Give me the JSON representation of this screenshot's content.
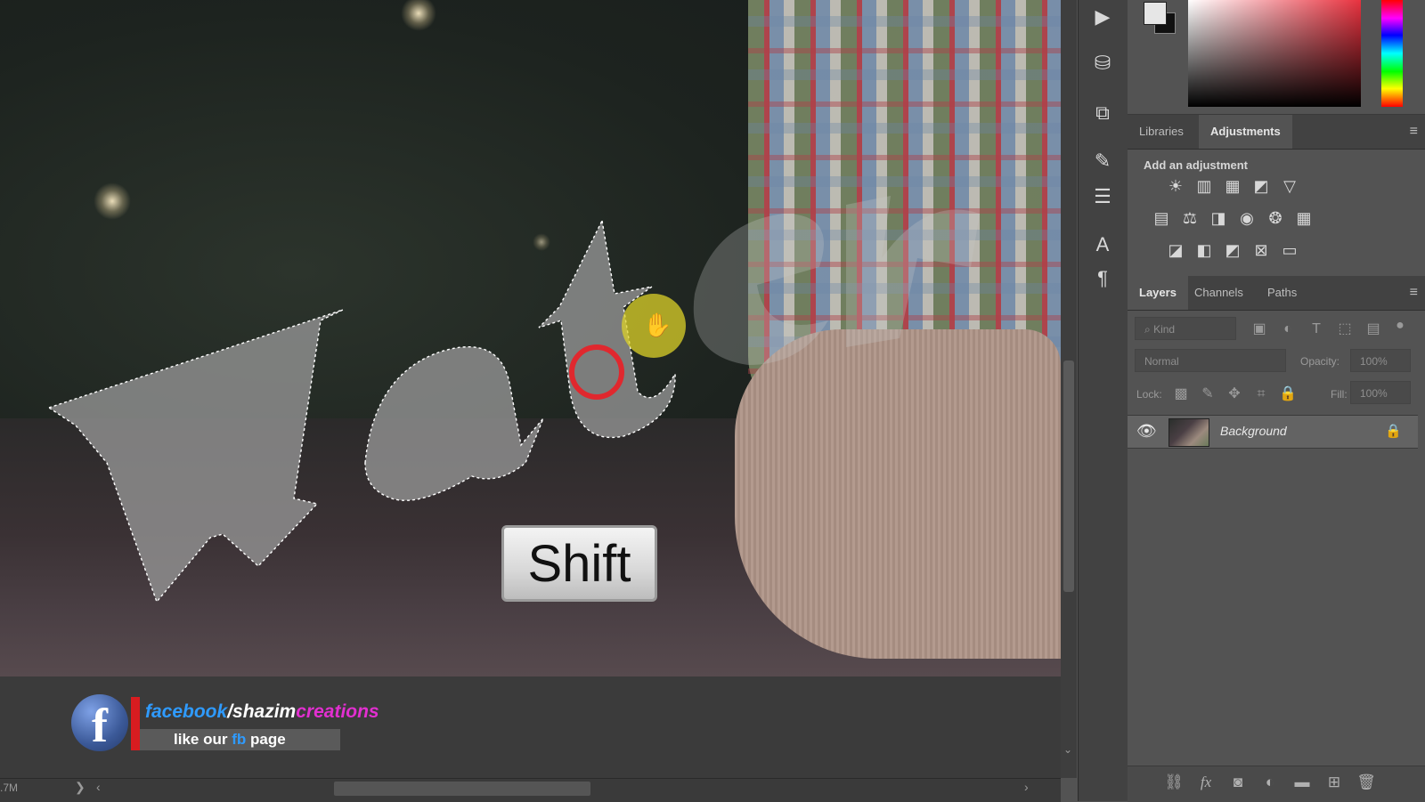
{
  "canvas": {
    "shift_key_label": "Shift",
    "status_doc_size": ".7M"
  },
  "watermark": {
    "facebook_part": "facebook",
    "slash_part": "/shazim",
    "creations_part": "creations",
    "like_prefix": "like our",
    "like_fb": "fb",
    "like_suffix": "page",
    "colors": {
      "facebook": "#2f9bff",
      "slash": "#ffffff",
      "creations": "#e22fd0",
      "fb_word": "#2f9bff"
    }
  },
  "top_panel": {
    "tabs": [
      {
        "label": "Libraries",
        "active": false
      },
      {
        "label": "Adjustments",
        "active": true
      }
    ],
    "section_title": "Add an adjustment",
    "adjustment_icons_row1": [
      "brightness-contrast-icon",
      "levels-icon",
      "curves-icon",
      "exposure-icon",
      "vibrance-icon"
    ],
    "adjustment_icons_row2": [
      "hue-saturation-icon",
      "color-balance-icon",
      "black-white-icon",
      "photo-filter-icon",
      "channel-mixer-icon",
      "color-lookup-icon"
    ],
    "adjustment_icons_row3": [
      "invert-icon",
      "posterize-icon",
      "threshold-icon",
      "selective-color-icon",
      "gradient-map-icon"
    ]
  },
  "layers_panel": {
    "tabs": [
      {
        "label": "Layers",
        "active": true
      },
      {
        "label": "Channels",
        "active": false
      },
      {
        "label": "Paths",
        "active": false
      }
    ],
    "filter_placeholder": "Kind",
    "blend_mode": "Normal",
    "opacity_label": "Opacity:",
    "opacity_value": "100%",
    "lock_label": "Lock:",
    "fill_label": "Fill:",
    "fill_value": "100%",
    "layers": [
      {
        "name": "Background",
        "visible": true,
        "locked": true
      }
    ]
  },
  "color": {
    "foreground": "#e6e6e6",
    "background": "#111111",
    "accent_hue": "#e8323f"
  }
}
